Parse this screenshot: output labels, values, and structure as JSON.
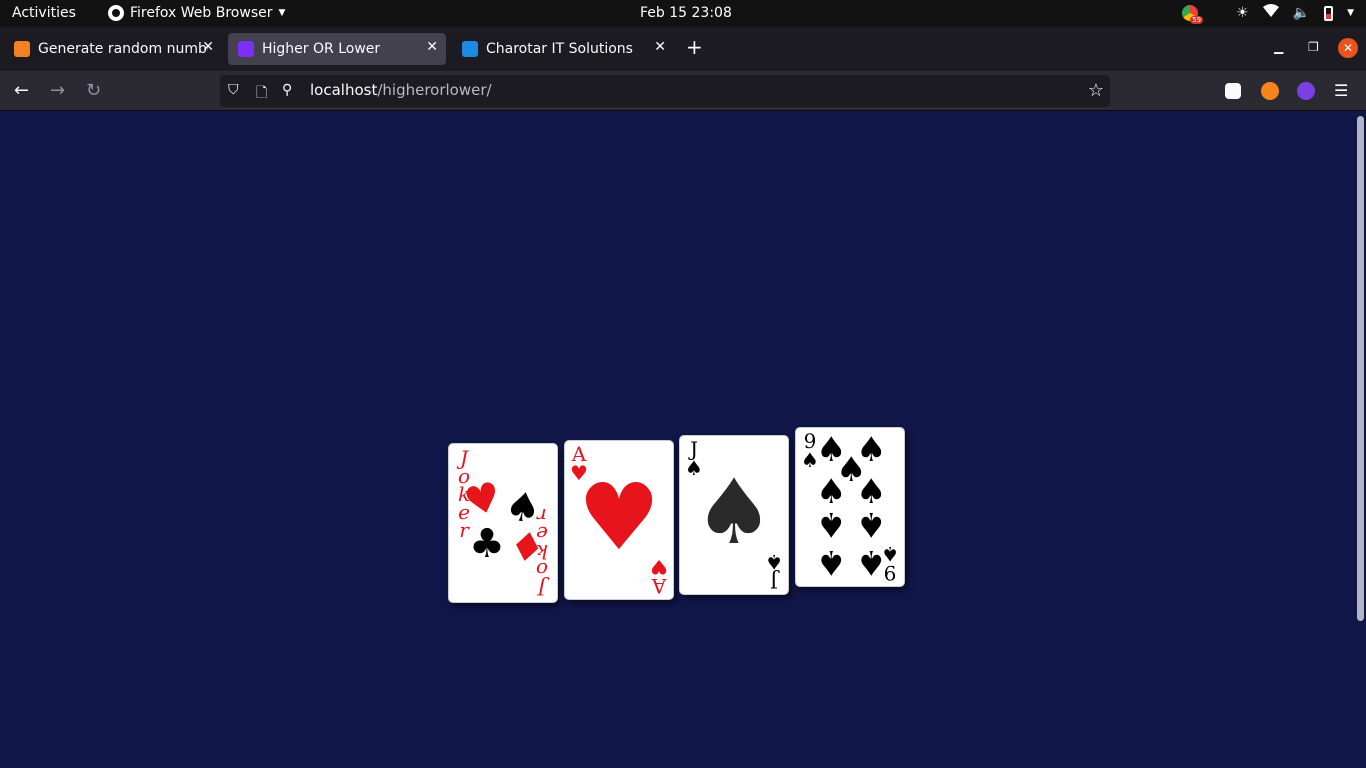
{
  "topbar": {
    "activities": "Activities",
    "app_name": "Firefox Web Browser",
    "clock": "Feb 15  23:08",
    "chrome_badge": "59"
  },
  "tabs": [
    {
      "title": "Generate random numbe",
      "favicon_color": "#f48024",
      "active": false
    },
    {
      "title": "Higher OR Lower",
      "favicon_color": "#7b2ff7",
      "active": true
    },
    {
      "title": "Charotar IT Solutions",
      "favicon_color": "#1e88e5",
      "active": false
    }
  ],
  "urlbar": {
    "host": "localhost",
    "path": "/higherorlower/"
  },
  "cards": [
    {
      "rank": "Joker",
      "suit": "joker",
      "color": "#e8141c"
    },
    {
      "rank": "A",
      "suit": "hearts",
      "color": "#e8141c"
    },
    {
      "rank": "J",
      "suit": "spades",
      "color": "#000000"
    },
    {
      "rank": "9",
      "suit": "spades",
      "color": "#000000"
    }
  ],
  "colors": {
    "page_bg": "#111649",
    "accent_close": "#e95420"
  }
}
